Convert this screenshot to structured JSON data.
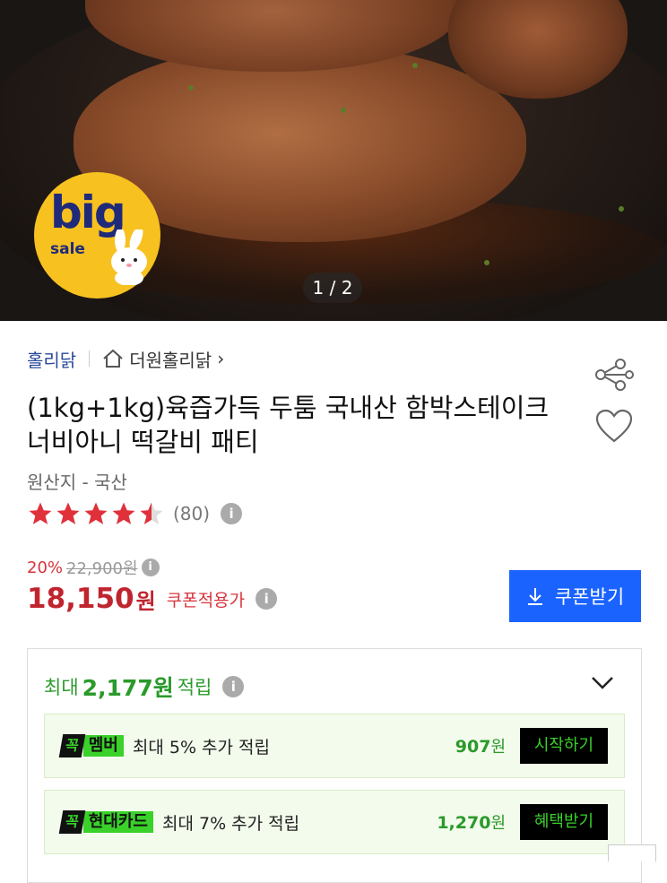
{
  "hero": {
    "counter": "1 / 2",
    "badge_big": "big",
    "badge_sale": "sale"
  },
  "brand": {
    "name": "홀리닭",
    "store": "더원홀리닭",
    "store_chevron": "›"
  },
  "product": {
    "title": "(1kg+1kg)육즙가득 두툼 국내산 함박스테이크 너비아니 떡갈비 패티",
    "origin": "원산지 - 국산",
    "rating": 4.5,
    "review_count": "(80)"
  },
  "price": {
    "discount": "20%",
    "original": "22,900원",
    "current": "18,150",
    "won": "원",
    "coupon_applied": "쿠폰적용가",
    "coupon_button": "쿠폰받기"
  },
  "points": {
    "prefix": "최대",
    "amount": "2,177원",
    "suffix": "적립",
    "cards": [
      {
        "tag_k": "꼭",
        "tag_t": "멤버",
        "text": "최대 5% 추가 적립",
        "amount": "907",
        "unit": "원",
        "button": "시작하기"
      },
      {
        "tag_k": "꼭",
        "tag_t": "현대카드",
        "text": "최대 7% 추가 적립",
        "amount": "1,270",
        "unit": "원",
        "button": "혜택받기"
      }
    ]
  },
  "icons": {
    "info": "i"
  },
  "colors": {
    "accent_blue": "#1a63ff",
    "price_red": "#c0242f",
    "point_green": "#2a9a2a",
    "badge_yellow": "#f7c11f"
  }
}
